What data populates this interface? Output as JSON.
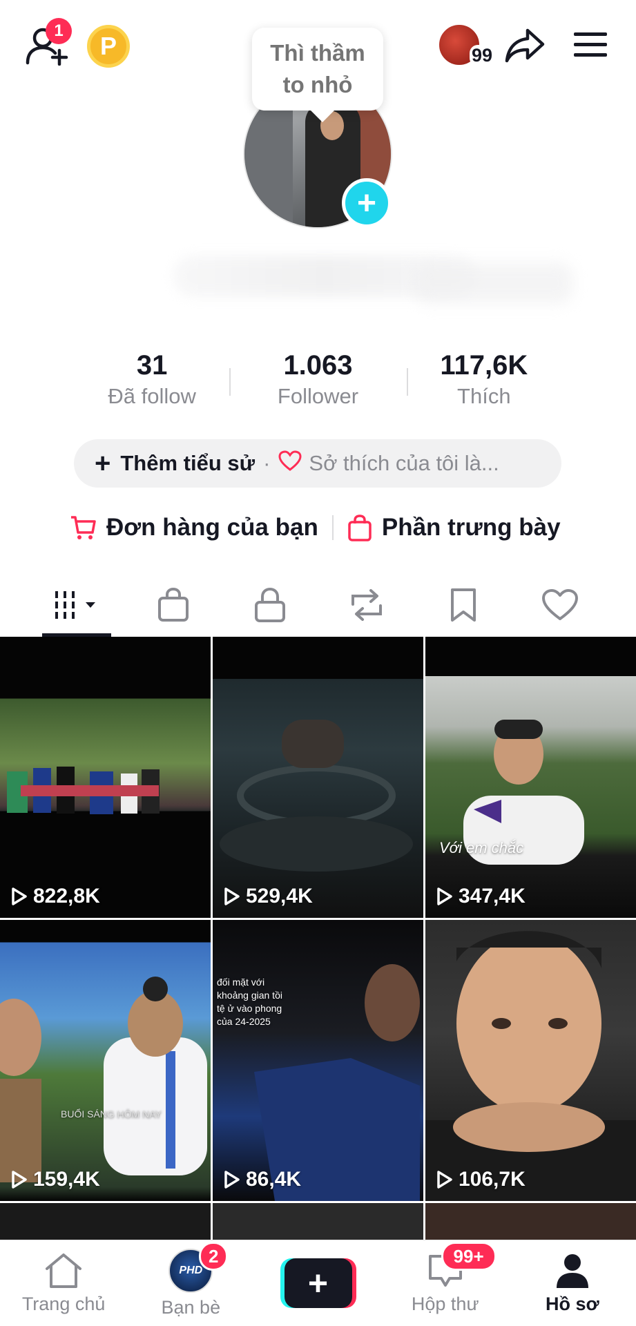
{
  "top_bar": {
    "add_friend_badge": "1",
    "coin_letter": "P",
    "profile_counter": "99",
    "icons": {
      "add_friend": "user-plus-icon",
      "coin": "coin-icon",
      "share": "share-icon",
      "menu": "hamburger-menu-icon"
    }
  },
  "profile": {
    "bubble_text_1": "Thì thầm",
    "bubble_text_2": "to nhỏ",
    "add_avatar_symbol": "+"
  },
  "stats": [
    {
      "value": "31",
      "label": "Đã follow"
    },
    {
      "value": "1.063",
      "label": "Follower"
    },
    {
      "value": "117,6K",
      "label": "Thích"
    }
  ],
  "bio": {
    "add_bio_label": "Thêm tiểu sử",
    "separator": "·",
    "hobby_placeholder": "Sở thích của tôi là..."
  },
  "orders": {
    "orders_label": "Đơn hàng của bạn",
    "showcase_label": "Phần trưng bày"
  },
  "tabs": [
    {
      "name": "videos",
      "icon": "grid-icon",
      "active": true
    },
    {
      "name": "shop",
      "icon": "shopping-bag-icon"
    },
    {
      "name": "private",
      "icon": "lock-icon"
    },
    {
      "name": "reposts",
      "icon": "repost-icon"
    },
    {
      "name": "favorites",
      "icon": "bookmark-icon"
    },
    {
      "name": "liked",
      "icon": "heart-icon"
    }
  ],
  "videos": [
    {
      "views": "822,8K"
    },
    {
      "views": "529,4K"
    },
    {
      "views": "347,4K"
    },
    {
      "views": "159,4K"
    },
    {
      "views": "86,4K"
    },
    {
      "views": "106,7K"
    }
  ],
  "video_overlay_texts": {
    "v3_caption": "Với em chắc",
    "v4_caption": "BUỔI SÁNG HÔM NAY",
    "v5_caption": "đối mặt với khoảng gian tồi tệ ử vào phong của 24-2025"
  },
  "bottom_nav": {
    "home": "Trang chủ",
    "friends": "Bạn bè",
    "friends_badge": "2",
    "create_symbol": "+",
    "inbox": "Hộp thư",
    "inbox_badge": "99+",
    "profile": "Hồ sơ"
  },
  "colors": {
    "accent_red": "#fe2c55",
    "accent_cyan": "#20d5ec",
    "text_primary": "#161823",
    "text_secondary": "#8a8b91"
  }
}
